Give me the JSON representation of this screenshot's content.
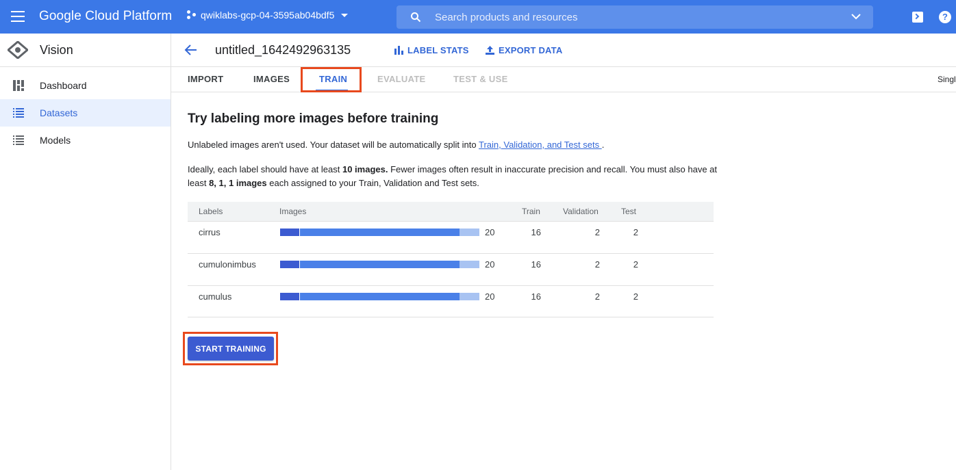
{
  "topbar": {
    "brand": "Google Cloud Platform",
    "project": "qwiklabs-gcp-04-3595ab04bdf5",
    "search_placeholder": "Search products and resources"
  },
  "sidebar": {
    "title": "Vision",
    "items": [
      {
        "label": "Dashboard",
        "icon": "dashboard-icon",
        "active": false
      },
      {
        "label": "Datasets",
        "icon": "list-icon",
        "active": true
      },
      {
        "label": "Models",
        "icon": "list-icon",
        "active": false
      }
    ]
  },
  "header": {
    "dataset_title": "untitled_1642492963135",
    "label_stats": "LABEL STATS",
    "export_data": "EXPORT DATA"
  },
  "tabs": [
    {
      "label": "IMPORT",
      "state": "normal"
    },
    {
      "label": "IMAGES",
      "state": "normal"
    },
    {
      "label": "TRAIN",
      "state": "active"
    },
    {
      "label": "EVALUATE",
      "state": "disabled"
    },
    {
      "label": "TEST & USE",
      "state": "disabled"
    }
  ],
  "tab_right": "Singl",
  "content": {
    "title": "Try labeling more images before training",
    "p1_text": "Unlabeled images aren't used. Your dataset will be automatically split into ",
    "p1_link": "Train, Validation, and Test sets ",
    "p1_end": ".",
    "p2_a": "Ideally, each label should have at least ",
    "p2_b": "10 images.",
    "p2_c": " Fewer images often result in inaccurate precision and recall. You must also have at least ",
    "p2_d": "8, 1, 1 images",
    "p2_e": " each assigned to your Train, Validation and Test sets."
  },
  "table": {
    "headers": {
      "labels": "Labels",
      "images": "Images",
      "train": "Train",
      "validation": "Validation",
      "test": "Test"
    },
    "rows": [
      {
        "label": "cirrus",
        "images": "20",
        "train": "16",
        "validation": "2",
        "test": "2"
      },
      {
        "label": "cumulonimbus",
        "images": "20",
        "train": "16",
        "validation": "2",
        "test": "2"
      },
      {
        "label": "cumulus",
        "images": "20",
        "train": "16",
        "validation": "2",
        "test": "2"
      }
    ],
    "bar_colors": {
      "dark": "#3c5bd1",
      "main": "#4a80e8",
      "light": "#a8c3f2"
    }
  },
  "start_training": "START TRAINING"
}
